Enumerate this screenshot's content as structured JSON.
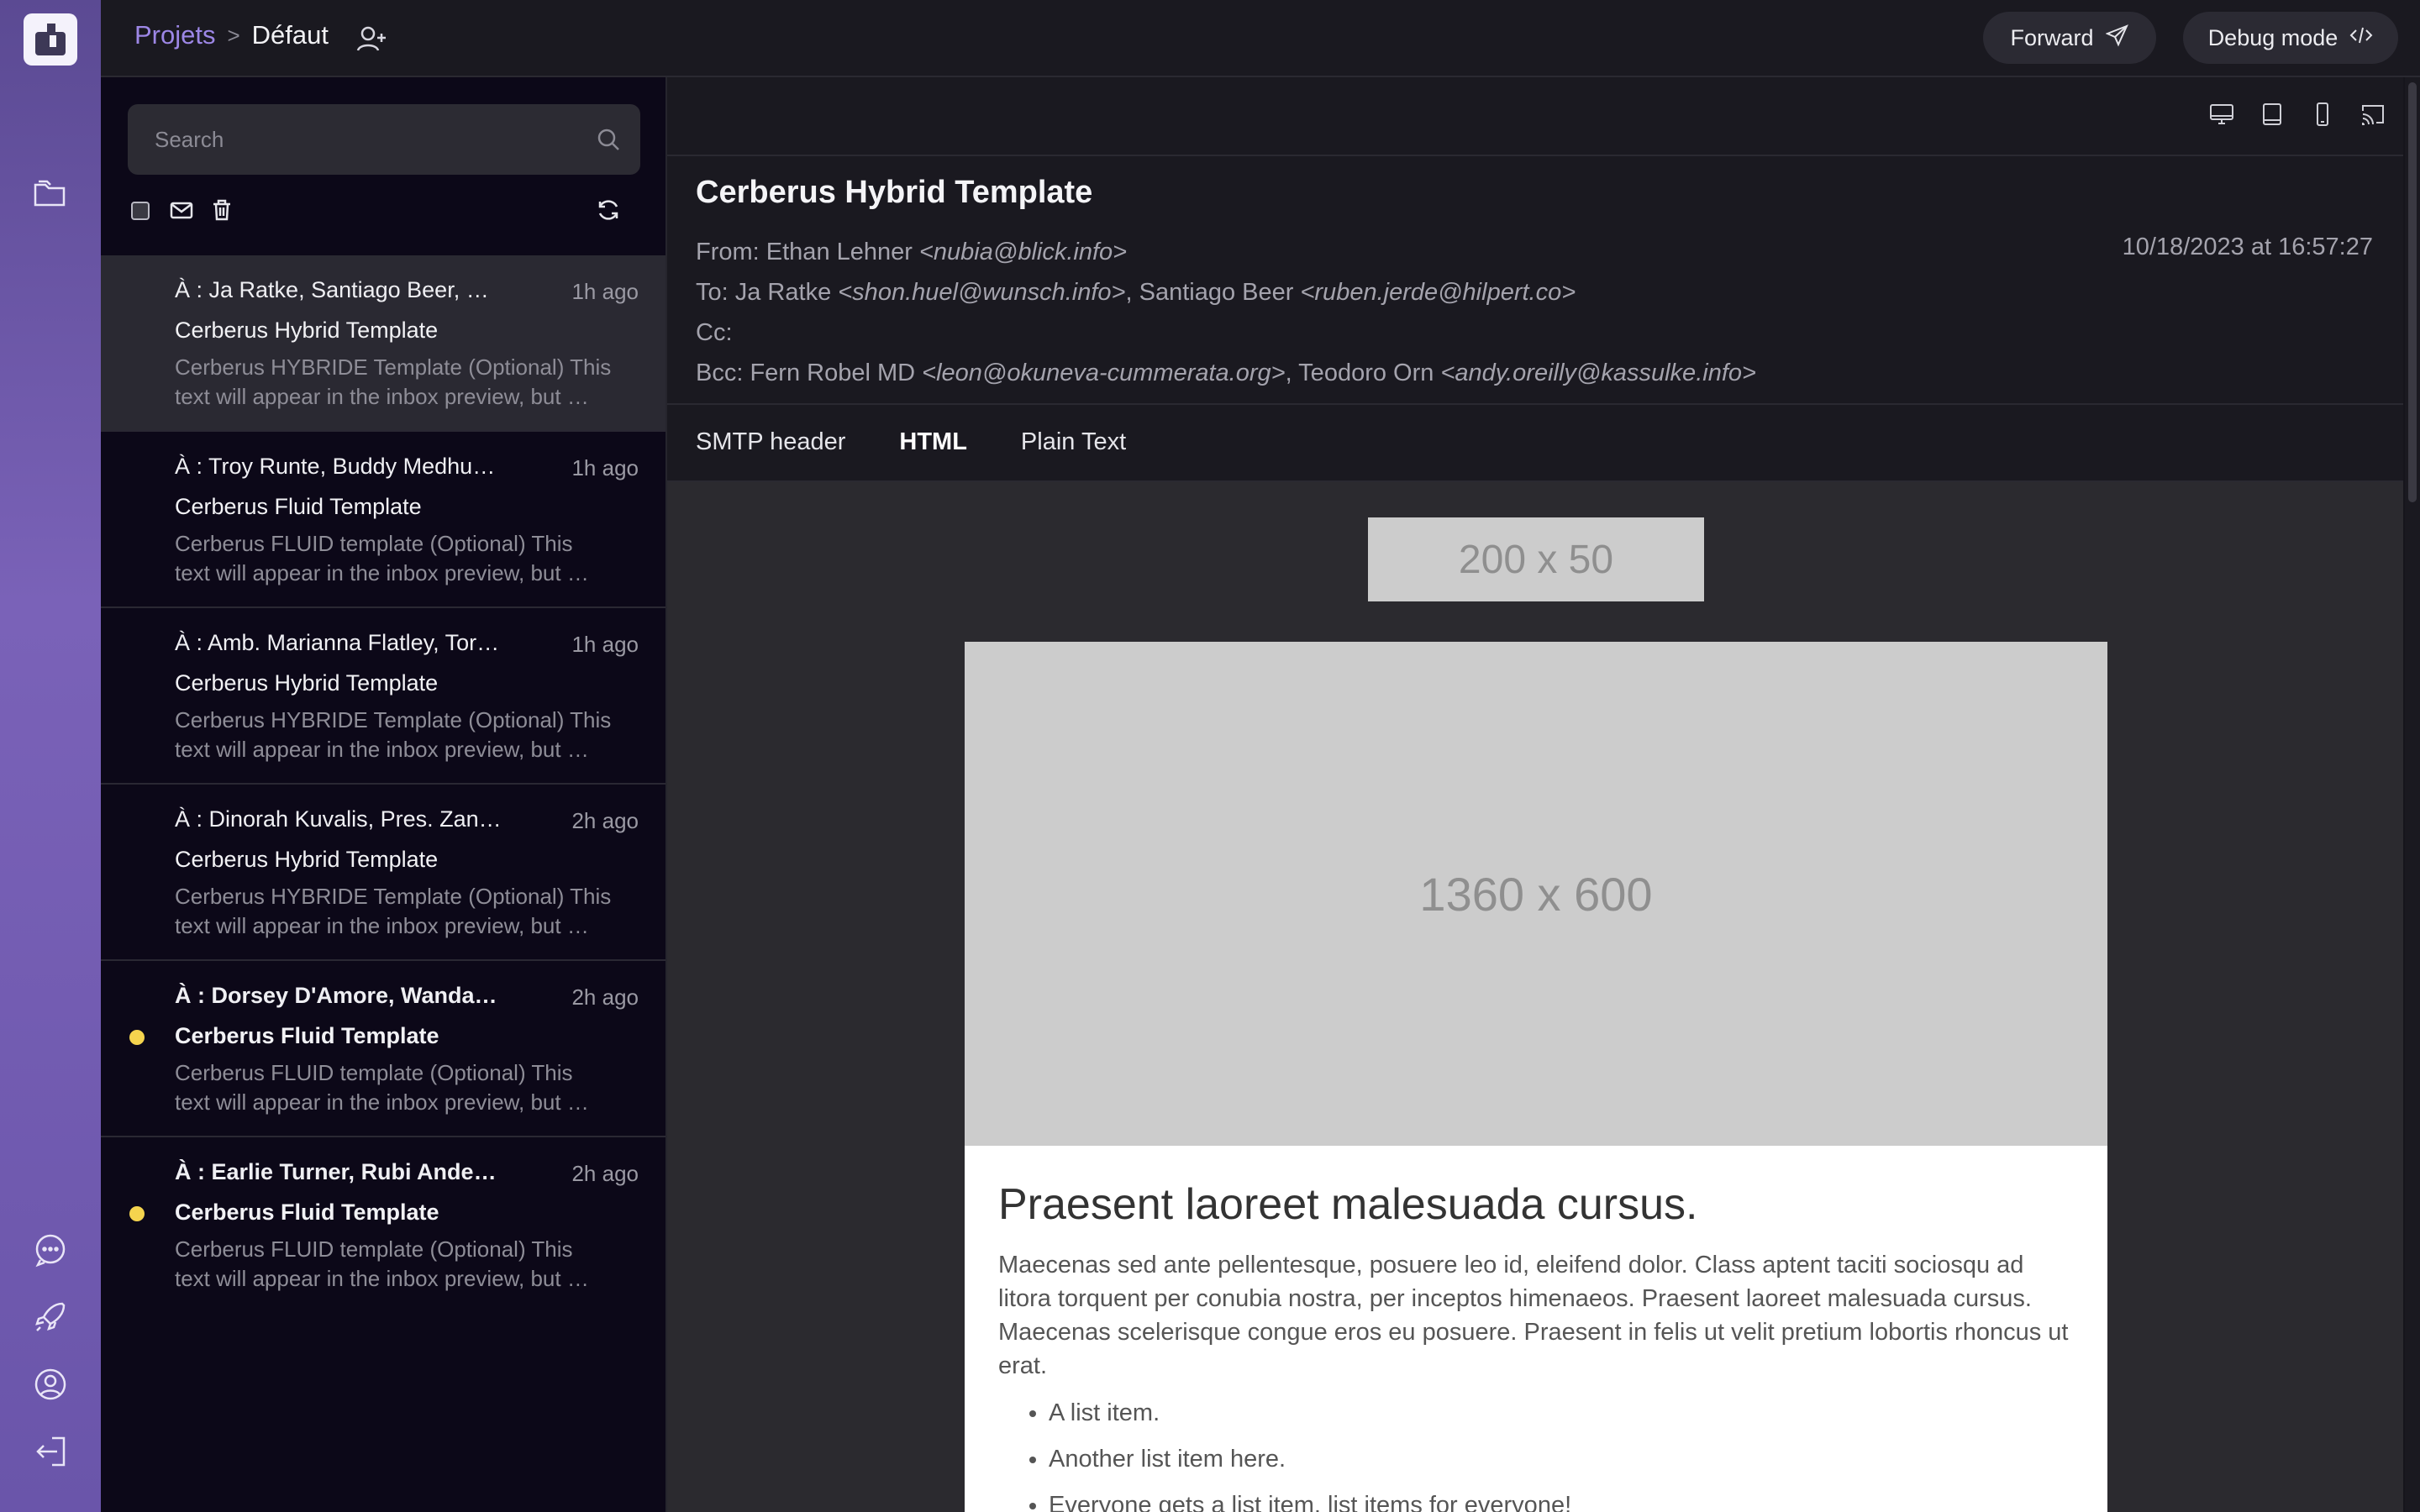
{
  "breadcrumb": {
    "project": "Projets",
    "separator": ">",
    "current": "Défaut"
  },
  "buttons": {
    "forward": "Forward",
    "debug": "Debug mode"
  },
  "search": {
    "placeholder": "Search"
  },
  "emails": [
    {
      "to": "À : Ja Ratke, Santiago Beer, Fe…",
      "time": "1h ago",
      "subject": "Cerberus Hybrid Template",
      "preview": "Cerberus HYBRIDE Template (Optional) This text will appear in the inbox preview, but …",
      "unread": false,
      "active": true
    },
    {
      "to": "À : Troy Runte, Buddy Medhur…",
      "time": "1h ago",
      "subject": "Cerberus Fluid Template",
      "preview": "Cerberus FLUID template (Optional) This text will appear in the inbox preview, but …",
      "unread": false,
      "active": false
    },
    {
      "to": "À : Amb. Marianna Flatley, Tori…",
      "time": "1h ago",
      "subject": "Cerberus Hybrid Template",
      "preview": "Cerberus HYBRIDE Template (Optional) This text will appear in the inbox preview, but …",
      "unread": false,
      "active": false
    },
    {
      "to": "À : Dinorah Kuvalis, Pres. Zane…",
      "time": "2h ago",
      "subject": "Cerberus Hybrid Template",
      "preview": "Cerberus HYBRIDE Template (Optional) This text will appear in the inbox preview, but …",
      "unread": false,
      "active": false
    },
    {
      "to": "À : Dorsey D'Amore, Wanda H…",
      "time": "2h ago",
      "subject": "Cerberus Fluid Template",
      "preview": "Cerberus FLUID template (Optional) This text will appear in the inbox preview, but …",
      "unread": true,
      "active": false
    },
    {
      "to": "À : Earlie Turner, Rubi Anders…",
      "time": "2h ago",
      "subject": "Cerberus Fluid Template",
      "preview": "Cerberus FLUID template (Optional) This text will appear in the inbox preview, but …",
      "unread": true,
      "active": false
    }
  ],
  "detail": {
    "title": "Cerberus Hybrid Template",
    "date": "10/18/2023 at 16:57:27",
    "from_label": "From: ",
    "from_name": "Ethan Lehner ",
    "from_addr": "<nubia@blick.info>",
    "to_label": "To: ",
    "to_1_name": "Ja Ratke ",
    "to_1_addr": "<shon.huel@wunsch.info>",
    "to_2_name": ", Santiago Beer ",
    "to_2_addr": "<ruben.jerde@hilpert.co>",
    "cc_label": "Cc:",
    "bcc_label": "Bcc: ",
    "bcc_1_name": "Fern Robel MD ",
    "bcc_1_addr": "<leon@okuneva-cummerata.org>",
    "bcc_2_name": ", Teodoro Orn ",
    "bcc_2_addr": "<andy.oreilly@kassulke.info>",
    "tabs": [
      "SMTP header",
      "HTML",
      "Plain Text"
    ],
    "selected_tab": "HTML"
  },
  "preview": {
    "logo_placeholder": "200 x 50",
    "hero_placeholder": "1360 x 600",
    "heading": "Praesent laoreet malesuada cursus.",
    "paragraph": "Maecenas sed ante pellentesque, posuere leo id, eleifend dolor. Class aptent taciti sociosqu ad litora torquent per conubia nostra, per inceptos himenaeos. Praesent laoreet malesuada cursus. Maecenas scelerisque congue eros eu posuere. Praesent in felis ut velit pretium lobortis rhoncus ut erat.",
    "list": [
      "A list item.",
      "Another list item here.",
      "Everyone gets a list item, list items for everyone!"
    ]
  },
  "colors": {
    "accent": "#9d87e6",
    "unread_dot": "#f5d44e",
    "rail": "#6a55aa"
  },
  "icons": [
    "mailbox-logo-icon",
    "folder-icon",
    "chat-icon",
    "rocket-icon",
    "user-circle-icon",
    "logout-icon",
    "add-user-icon",
    "send-icon",
    "code-icon",
    "search-icon",
    "checkbox-icon",
    "envelope-icon",
    "trash-icon",
    "refresh-icon",
    "desktop-icon",
    "tablet-icon",
    "phone-icon",
    "cast-icon"
  ]
}
